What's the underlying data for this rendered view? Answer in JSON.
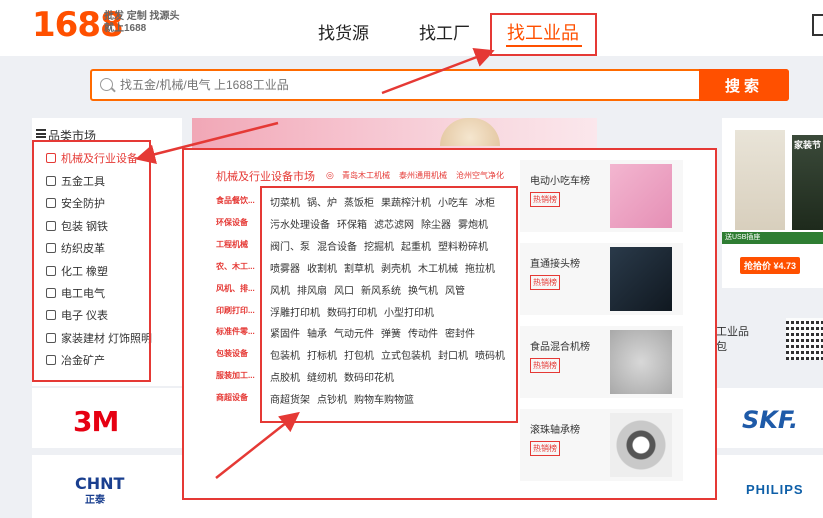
{
  "header": {
    "logo": "1688",
    "slogan_line1": "批发 定制 找源头",
    "slogan_line2": "就上1688",
    "nav": [
      {
        "label": "找货源"
      },
      {
        "label": "找工厂"
      },
      {
        "label": "找工业品"
      }
    ]
  },
  "search": {
    "placeholder": "找五金/机械/电气 上1688工业品",
    "button": "搜索"
  },
  "categories": {
    "title": "品类市场",
    "items": [
      {
        "label": "机械及行业设备",
        "icon": "machine-icon"
      },
      {
        "label": "五金工具",
        "icon": "tool-icon"
      },
      {
        "label": "安全防护",
        "icon": "shield-icon"
      },
      {
        "label": "包装  钢铁",
        "icon": "package-icon"
      },
      {
        "label": "纺织皮革",
        "icon": "textile-icon"
      },
      {
        "label": "化工  橡塑",
        "icon": "chemical-icon"
      },
      {
        "label": "电工电气",
        "icon": "electric-icon"
      },
      {
        "label": "电子  仪表",
        "icon": "electronics-icon"
      },
      {
        "label": "家装建材  灯饰照明",
        "icon": "home-icon"
      },
      {
        "label": "冶金矿产",
        "icon": "mining-icon"
      }
    ]
  },
  "dropdown": {
    "title": "机械及行业设备市场",
    "hot_links": [
      "青岛木工机械",
      "泰州通用机械",
      "沧州空气净化"
    ],
    "rows": [
      {
        "label": "食品餐饮...",
        "items": [
          "切菜机",
          "锅、炉",
          "蒸饭柜",
          "果蔬榨汁机",
          "小吃车",
          "冰柜"
        ]
      },
      {
        "label": "环保设备",
        "items": [
          "污水处理设备",
          "环保箱",
          "滤芯滤网",
          "除尘器",
          "雾炮机"
        ]
      },
      {
        "label": "工程机械",
        "items": [
          "阀门、泵",
          "混合设备",
          "挖掘机",
          "起重机",
          "塑料粉碎机"
        ]
      },
      {
        "label": "农、木工...",
        "items": [
          "喷雾器",
          "收割机",
          "割草机",
          "剥壳机",
          "木工机械",
          "拖拉机"
        ]
      },
      {
        "label": "风机、排...",
        "items": [
          "风机",
          "排风扇",
          "风口",
          "新风系统",
          "换气机",
          "风管"
        ]
      },
      {
        "label": "印刷打印...",
        "items": [
          "浮雕打印机",
          "数码打印机",
          "小型打印机"
        ]
      },
      {
        "label": "标准件零...",
        "items": [
          "紧固件",
          "轴承",
          "气动元件",
          "弹簧",
          "传动件",
          "密封件"
        ]
      },
      {
        "label": "包装设备",
        "items": [
          "包装机",
          "打标机",
          "打包机",
          "立式包装机",
          "封口机",
          "喷码机"
        ]
      },
      {
        "label": "服装加工...",
        "items": [
          "点胶机",
          "缝纫机",
          "数码印花机"
        ]
      },
      {
        "label": "商超设备",
        "items": [
          "商超货架",
          "点钞机",
          "购物车购物篮"
        ]
      }
    ]
  },
  "hot_products": [
    {
      "name": "电动小吃车榜",
      "tag": "热销榜"
    },
    {
      "name": "直通接头榜",
      "tag": "热销榜"
    },
    {
      "name": "食品混合机榜",
      "tag": "热销榜"
    },
    {
      "name": "滚珠轴承榜",
      "tag": "热销榜"
    }
  ],
  "right_panel": {
    "ad_tag": "家装节",
    "banner_text": "送USB插座",
    "price_text": "抢拾价 ¥4.73",
    "text_line1": "工业品",
    "text_line2": "包"
  },
  "brands": [
    "3M",
    "SKF.",
    "CHNT",
    "正泰",
    "PHILIPS"
  ]
}
